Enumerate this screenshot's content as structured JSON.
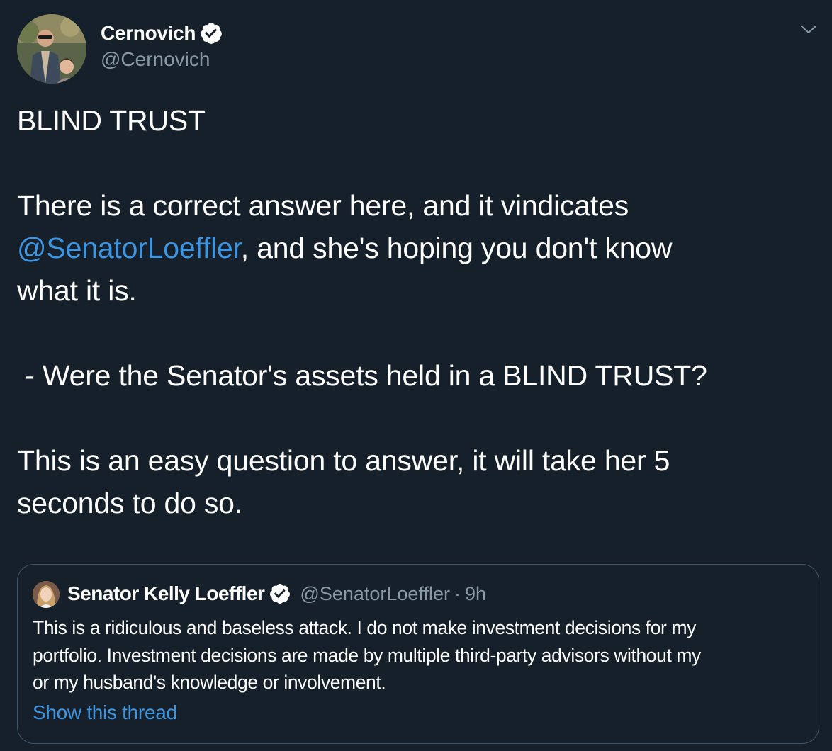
{
  "colors": {
    "background": "#15202b",
    "text_primary": "#ffffff",
    "text_secondary": "#8899a6",
    "link": "#3d95e0",
    "verified_badge": "#ffffff",
    "quote_border": "#3d5466"
  },
  "author": {
    "name": "Cernovich",
    "handle": "@Cernovich",
    "verified": true,
    "avatar_icon": "profile-photo",
    "verified_icon": "verified-badge-icon"
  },
  "menu": {
    "icon": "chevron-down-icon"
  },
  "tweet": {
    "line1": "BLIND TRUST",
    "line2_a": "There is a correct answer here, and it vindicates",
    "line2_mention": "@SenatorLoeffler",
    "line2_b": ", and she's hoping you don't know",
    "line2_c": "what it is.",
    "line3": " - Were the Senator's assets held in a BLIND TRUST?",
    "line4_a": "This is an easy question to answer, it will take her 5",
    "line4_b": "seconds to do so."
  },
  "quoted_tweet": {
    "name": "Senator Kelly Loeffler",
    "handle": "@SenatorLoeffler",
    "separator": "·",
    "time": "9h",
    "verified": true,
    "text_line1": "This is a ridiculous and baseless attack. I do not make investment decisions for my",
    "text_line2": "portfolio. Investment decisions are made by multiple third-party advisors without my",
    "text_line3": "or my husband's knowledge or involvement.",
    "show_thread": "Show this thread"
  }
}
